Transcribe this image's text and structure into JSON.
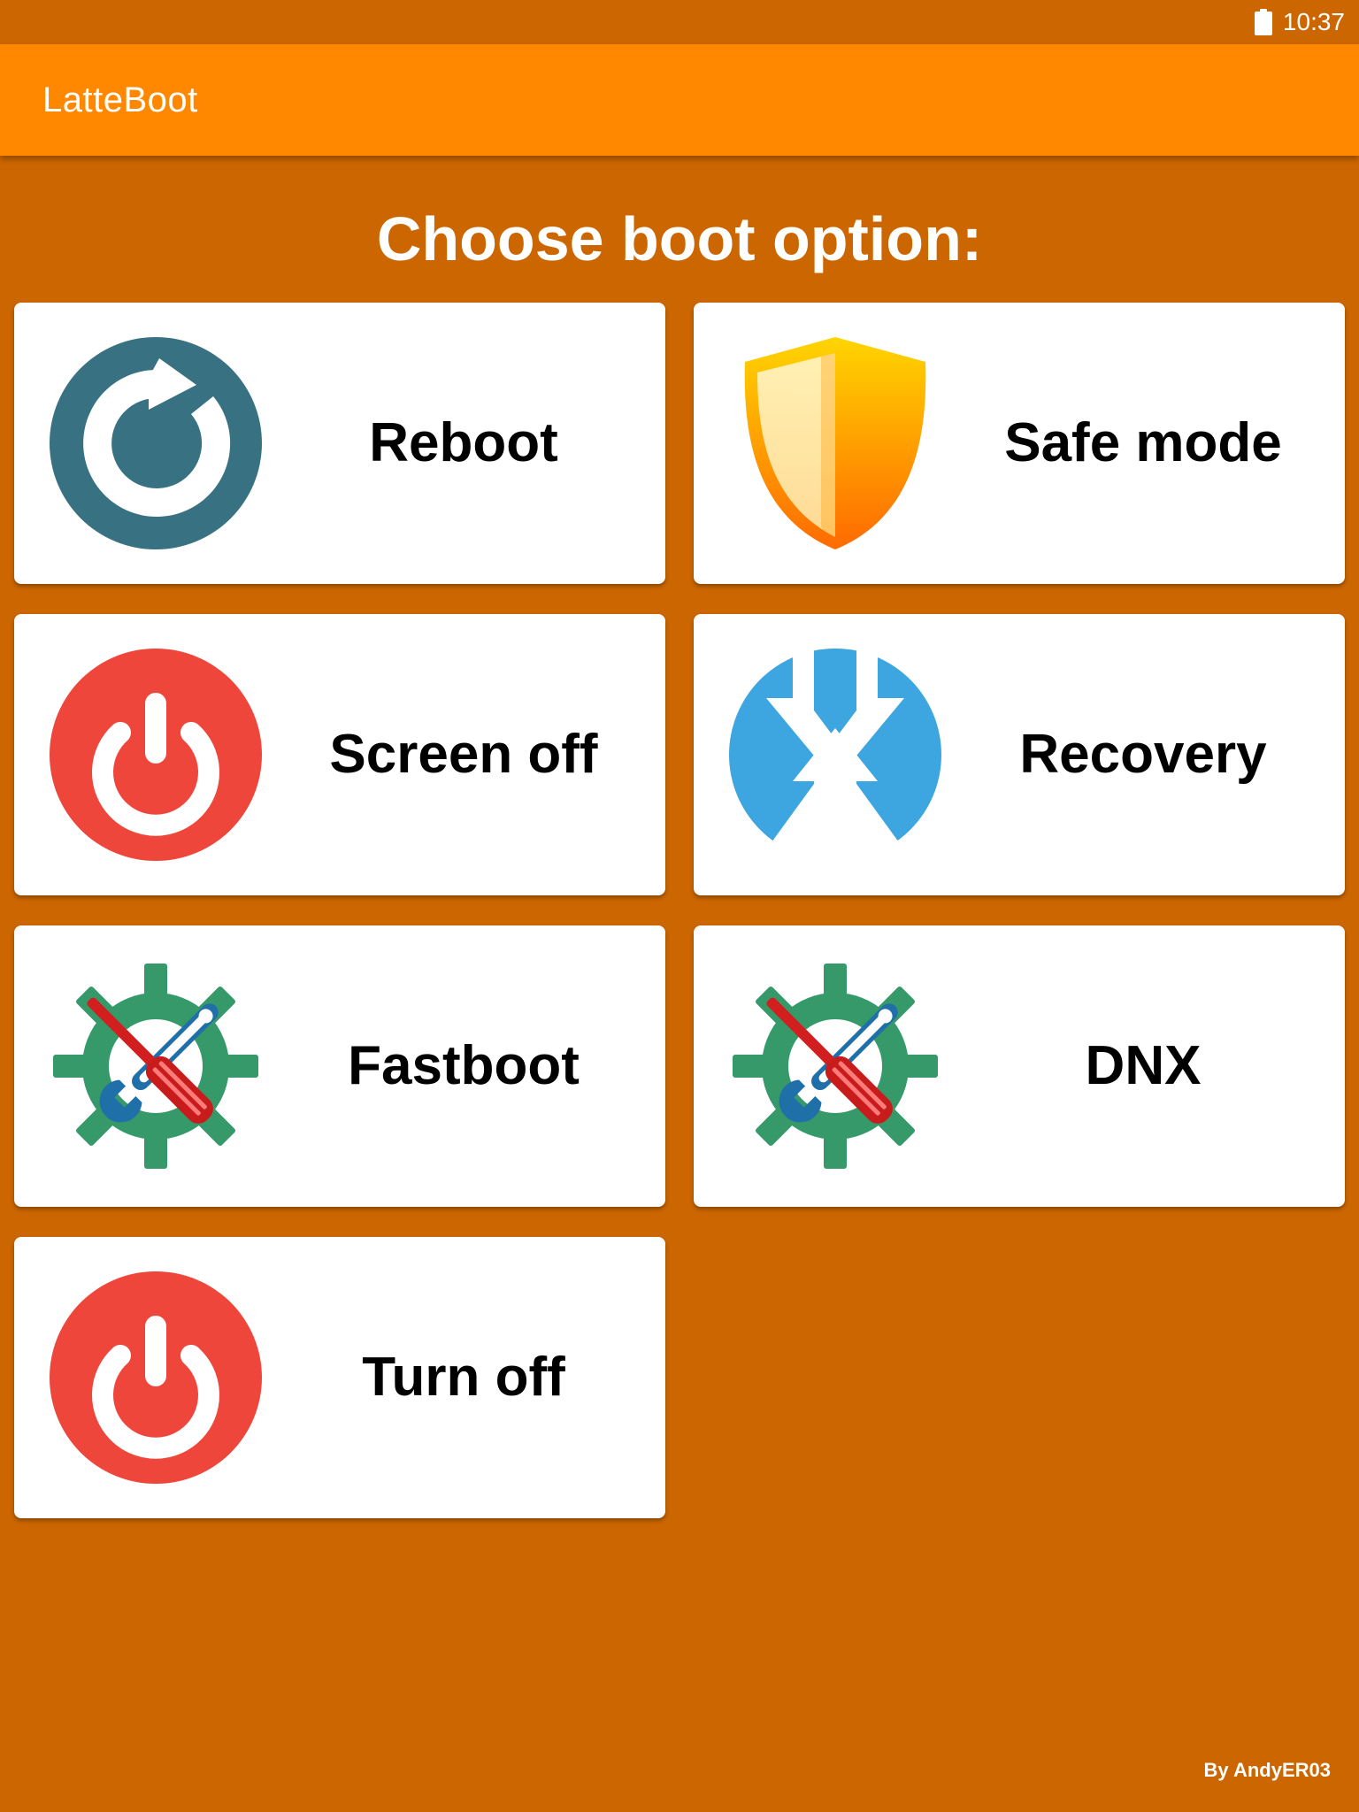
{
  "status_bar": {
    "time": "10:37",
    "battery_icon": "battery-full-icon"
  },
  "app_bar": {
    "title": "LatteBoot"
  },
  "heading": "Choose boot option:",
  "options": [
    {
      "label": "Reboot",
      "icon": "reboot-icon"
    },
    {
      "label": "Safe mode",
      "icon": "shield-icon"
    },
    {
      "label": "Screen off",
      "icon": "power-icon"
    },
    {
      "label": "Recovery",
      "icon": "recovery-arrows-icon"
    },
    {
      "label": "Fastboot",
      "icon": "tools-gear-icon"
    },
    {
      "label": "DNX",
      "icon": "tools-gear-icon"
    },
    {
      "label": "Turn off",
      "icon": "power-icon"
    }
  ],
  "footer": "By AndyER03",
  "colors": {
    "background": "#CC6600",
    "app_bar": "#FF8800",
    "card": "#FFFFFF",
    "reboot_circle": "#387282",
    "power_circle": "#EF463C",
    "recovery_circle": "#3DA5DF",
    "gear": "#36996A",
    "shield_top": "#FFD000",
    "shield_bottom": "#FF6A00"
  }
}
